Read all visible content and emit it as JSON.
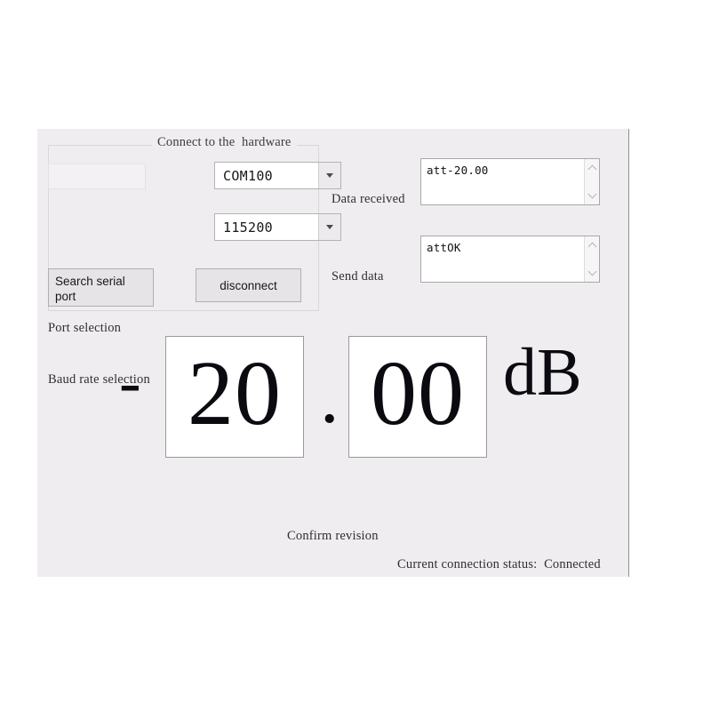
{
  "window": {
    "background_color": "#efedef"
  },
  "connect_group": {
    "title": "Connect to the  hardware",
    "port": {
      "label": "Port selection",
      "selected": "COM100",
      "options": [
        "COM100"
      ],
      "arrow_icon": "chevron-down-icon"
    },
    "baud": {
      "label": "Baud rate selection",
      "selected": "115200",
      "options": [
        "115200"
      ],
      "arrow_icon": "chevron-down-icon"
    },
    "search_button": {
      "line1": "Search serial",
      "line2": "port"
    },
    "disconnect_button": {
      "label": "disconnect"
    }
  },
  "serial_io": {
    "received": {
      "label": "Data received",
      "value": "att-20.00",
      "scroll_up_icon": "chevron-up-icon",
      "scroll_down_icon": "chevron-down-icon"
    },
    "send": {
      "label": "Send data",
      "value": "attOK",
      "scroll_up_icon": "chevron-up-icon",
      "scroll_down_icon": "chevron-down-icon"
    }
  },
  "readout": {
    "sign": "-",
    "integer_part": "20",
    "decimal_separator": ".",
    "fraction_part": "00",
    "unit": "dB"
  },
  "footer": {
    "confirm_label": "Confirm revision",
    "status_label": "Current connection status:  Connected"
  }
}
